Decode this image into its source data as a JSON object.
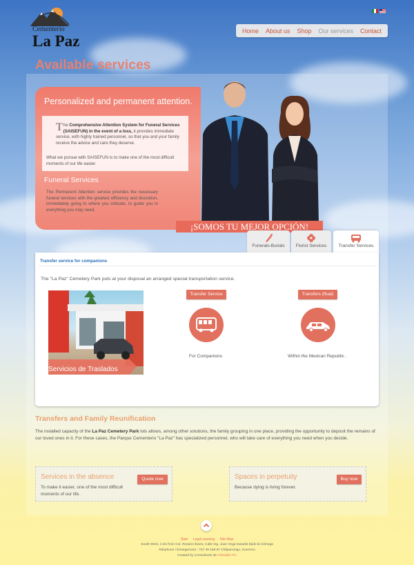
{
  "logo": {
    "top_text": "Cementerio",
    "name": "La Paz"
  },
  "flags": [
    {
      "name": "mexico-flag-icon"
    },
    {
      "name": "usa-flag-icon"
    }
  ],
  "nav": {
    "items": [
      {
        "label": "Home",
        "active": false
      },
      {
        "label": "About us",
        "active": false
      },
      {
        "label": "Shop",
        "active": false
      },
      {
        "label": "Our services",
        "active": true
      },
      {
        "label": "Contact",
        "active": false
      }
    ]
  },
  "page_title": "Available services",
  "hero": {
    "title": "Personalized and permanent attention.",
    "intro_dropcap": "T",
    "intro_pre": "he ",
    "intro_bold": "Comprehensive Attention System for Funeral Services (SAISEFUN) in the event of a loss,",
    "intro_rest": " it provides immediate service, with highly trained personnel, so that you and your family receive the advice and care they deserve.",
    "paragraph2": "What we pursue with SAISEFUN is to make one of the most difficult moments of our life easier.",
    "subtitle": "Funeral Services",
    "paragraph3": "The Permanent Attention service provides the necessary funeral services with the greatest efficiency and discretion, immediately going to where you indicate, to guide you in everything you may need.",
    "slogan": "¡SOMOS TU MEJOR OPCIÓN!"
  },
  "tabs": [
    {
      "label": "Funerals-Burials",
      "icon": "candle-icon"
    },
    {
      "label": "Florist Services",
      "icon": "flower-icon"
    },
    {
      "label": "Transfer Services",
      "icon": "car-icon"
    }
  ],
  "transfer": {
    "heading": "Transfer service for companions",
    "description": "The \"La Paz\" Cemetery Park puts at your disposal an arranged special transportation service.",
    "photo_caption": "Servicios de Traslados",
    "options": [
      {
        "button": "Transfer Service",
        "icon": "bus-icon",
        "label": "For Companions"
      },
      {
        "button": "Transfers (float)",
        "icon": "hearse-icon",
        "label": "Within the Mexican Republic ."
      }
    ]
  },
  "reunification": {
    "title": "Transfers and Family Reunification",
    "text_pre": "The installed capacity of the ",
    "text_bold": "La Paz Cemetery Park",
    "text_post": " lots allows, among other solutions, the family grouping in one place, providing the opportunity to deposit the remains of our loved ones in it. For these cases, the Parque Cementerio \"La Paz\" has specialized personnel, who will take care of everything you need when you decide."
  },
  "promos": [
    {
      "title": "Services in the absence",
      "button": "Quote now",
      "text": "To make it easier, one of the most difficult moments of our life."
    },
    {
      "title": "Spaces in perpetuity",
      "button": "Buy now",
      "text": "Because dying is living forever."
    }
  ],
  "footer": {
    "links": [
      "Start",
      "Legal warning",
      "Site Map"
    ],
    "address": "South West, 1 km from Col. Rosario Ibarra, Calle Ing. Juan Vega towards Ejido la Ciénega",
    "phone": "Telephone / Emergencies : 747 49 158 87 Chilpancingo, Guerrero",
    "credit_pre": "Created by Consultores de ",
    "credit_link": "Virtualità TIC"
  },
  "colors": {
    "accent": "#e1705e",
    "link_blue": "#2a6fb8",
    "title_salmon": "#e88070"
  }
}
